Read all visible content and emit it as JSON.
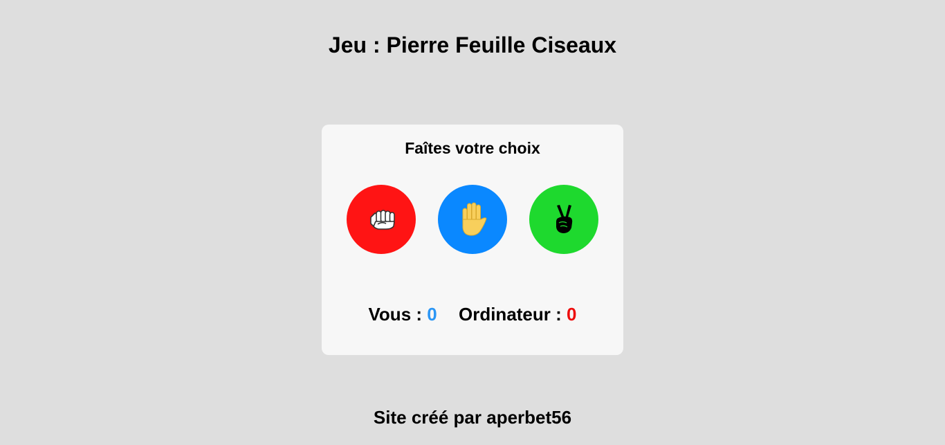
{
  "header": {
    "title": "Jeu : Pierre Feuille Ciseaux"
  },
  "game": {
    "prompt": "Faîtes votre choix",
    "choices": [
      {
        "id": "pierre",
        "icon": "fist-icon",
        "color": "#ff1414"
      },
      {
        "id": "feuille",
        "icon": "raised-hand-icon",
        "color": "#0a88ff"
      },
      {
        "id": "ciseaux",
        "icon": "victory-hand-icon",
        "color": "#1ed92e"
      }
    ],
    "score": {
      "user_label": "Vous :",
      "user_value": "0",
      "user_color": "#2b96f5",
      "cpu_label": "Ordinateur :",
      "cpu_value": "0",
      "cpu_color": "#ee0d0d"
    }
  },
  "footer": {
    "credit": "Site créé par aperbet56"
  }
}
